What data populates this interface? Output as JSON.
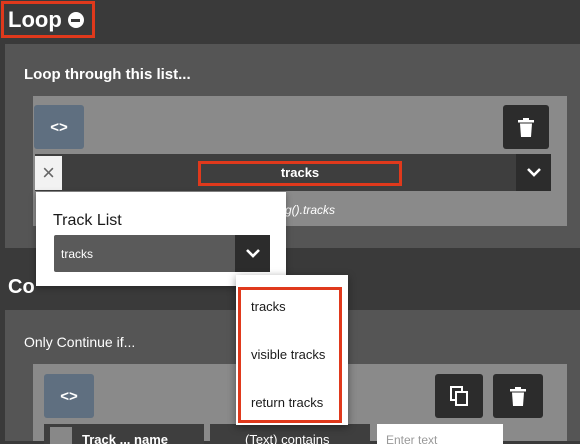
{
  "loop_section": {
    "title": "Loop",
    "list_label": "Loop through this list...",
    "code_toggle_label": "<>",
    "selected_value": "tracks",
    "expression_hint": "g().tracks"
  },
  "track_list_popup": {
    "label": "Track List",
    "selected_value": "tracks"
  },
  "dropdown_options": [
    "tracks",
    "visible tracks",
    "return tracks"
  ],
  "continue_section": {
    "title": "Co",
    "condition_label": "Only Continue if...",
    "code_toggle_label": "<>",
    "field_label": "Track ... name",
    "operator_label": "(Text) contains",
    "value_placeholder": "Enter text"
  },
  "colors": {
    "highlight": "#e0391c",
    "background": "#3a3a3a",
    "panel": "#555555"
  }
}
